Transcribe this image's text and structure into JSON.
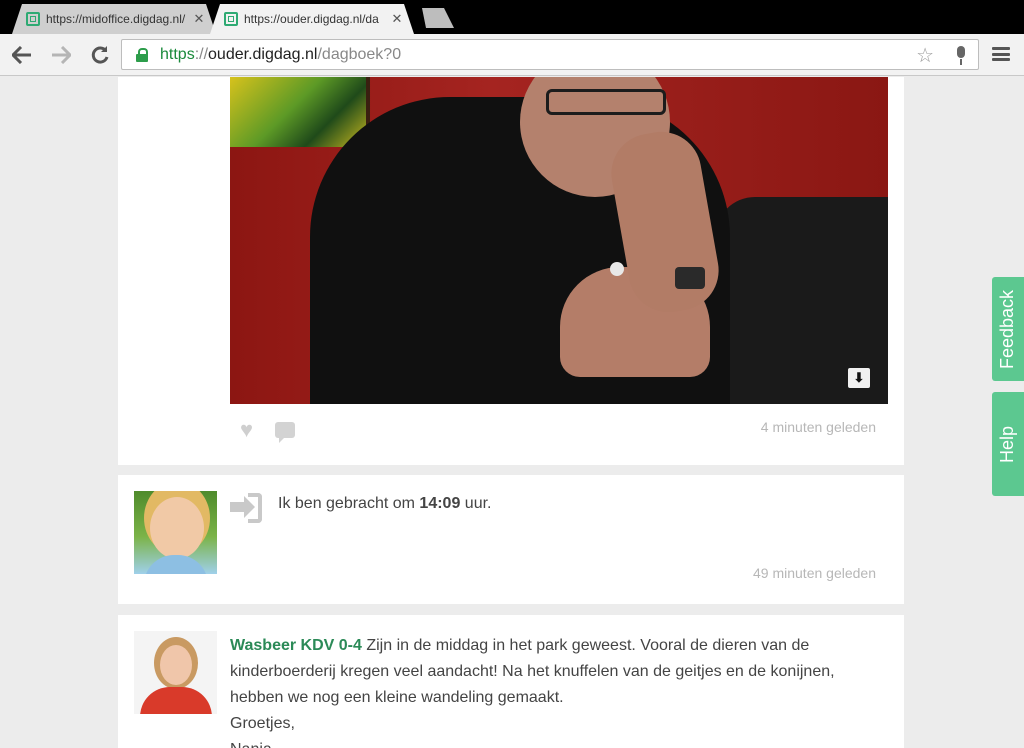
{
  "browser": {
    "tabs": [
      {
        "title": "https://midoffice.digdag.nl/",
        "active": false
      },
      {
        "title": "https://ouder.digdag.nl/da",
        "active": true
      }
    ],
    "url": {
      "scheme": "https",
      "separator": "://",
      "host": "ouder.digdag.nl",
      "path": "/dagboek?0"
    }
  },
  "posts": [
    {
      "type": "photo",
      "time_ago": "4 minuten geleden"
    },
    {
      "type": "checkin",
      "text_before": "Ik ben gebracht om ",
      "time": "14:09",
      "text_after": " uur.",
      "time_ago": "49 minuten geleden"
    },
    {
      "type": "message",
      "group": "Wasbeer KDV 0-4",
      "body": " Zijn in de middag in het park geweest. Vooral de dieren van de kinderboerderij kregen veel aandacht! Na het knuffelen van de geitjes en de konijnen, hebben we nog een kleine wandeling gemaakt.",
      "greeting": "Groetjes,",
      "signature": "Nanja"
    }
  ],
  "side_tabs": {
    "feedback": "Feedback",
    "help": "Help"
  },
  "icons": {
    "back": "back-arrow-icon",
    "forward": "forward-arrow-icon",
    "reload": "reload-icon",
    "lock": "lock-icon",
    "bookmark": "star-icon",
    "voice": "microphone-icon",
    "menu": "hamburger-menu-icon",
    "like": "heart-icon",
    "comment": "comment-bubble-icon",
    "download": "download-icon",
    "checkin": "sign-in-icon"
  },
  "colors": {
    "accent": "#5cc890",
    "group_name": "#2b8a57",
    "url_secure": "#1a8a3b"
  }
}
